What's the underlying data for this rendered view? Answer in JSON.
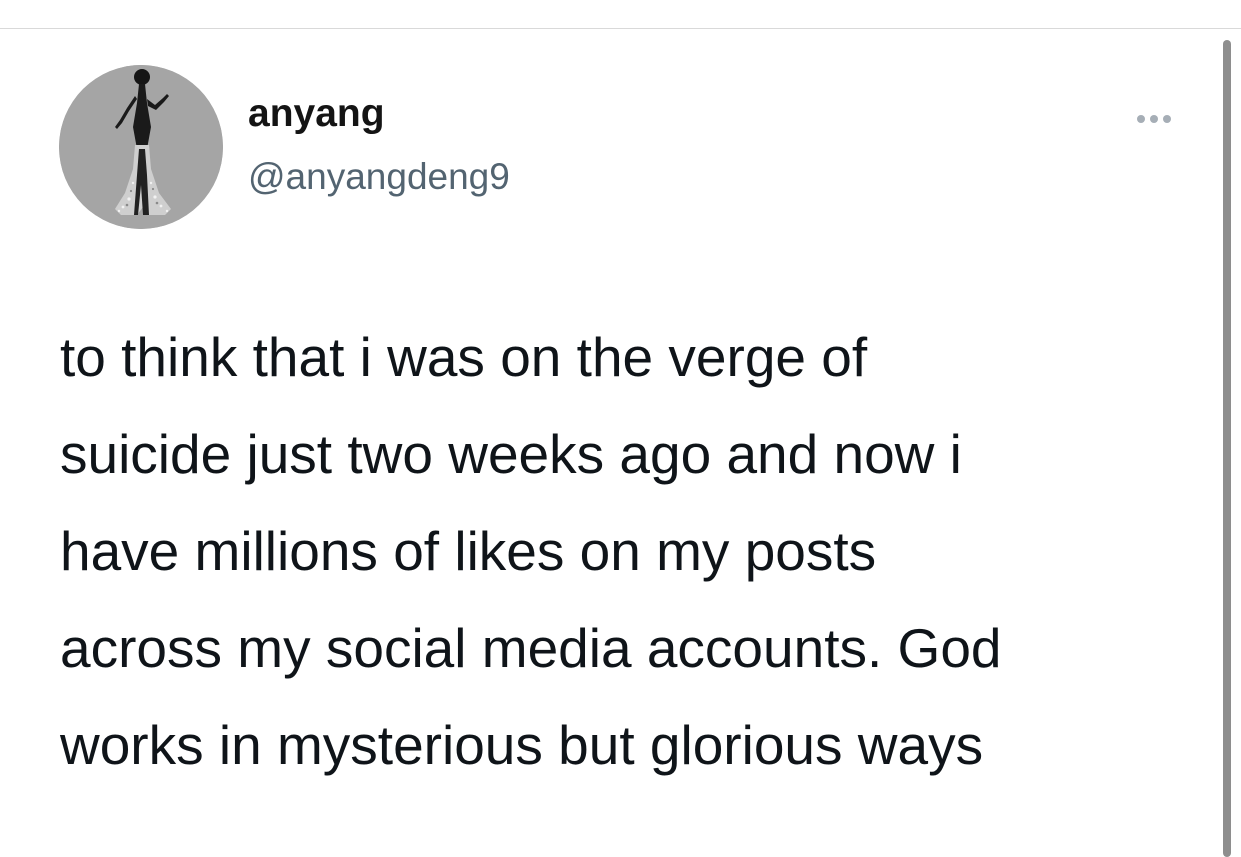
{
  "tweet": {
    "author": {
      "display_name": "anyang",
      "handle": "@anyangdeng9",
      "avatar_icon": "avatar-figure-icon"
    },
    "more_icon": "ellipsis-icon",
    "text": "to think that i was on the verge of\nsuicide just two weeks ago and now i\nhave millions of likes on my posts\nacross my social media accounts. God\nworks in mysterious but glorious ways"
  },
  "colors": {
    "text": "#0f1419",
    "handle": "#536471",
    "avatar_bg": "#a5a5a5",
    "more_dots": "#a6aeb6"
  }
}
